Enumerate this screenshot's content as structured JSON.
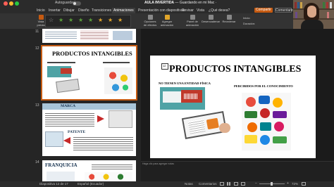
{
  "titlebar": {
    "autosave_label": "Autoguardado",
    "doc_name": "AULA INVERTIDA",
    "doc_status": " — Guardando en mi Mac ·"
  },
  "menu": {
    "items": [
      "Inicio",
      "Insertar",
      "Dibujar",
      "Diseño",
      "Transiciones",
      "Animaciones",
      "Presentación con diapositivas",
      "Revisar",
      "Vista",
      "¿Qué desea?"
    ],
    "active": "Animaciones",
    "share_label": "Compartir",
    "comments_label": "Comentarios"
  },
  "ribbon": {
    "preview_label": "Vista previa",
    "effect_options": "Opciones de efectos",
    "add_animation": "Agregar animación",
    "animation_pane": "Panel de animación",
    "trigger": "Desencadenar",
    "reorder": "Reordenar",
    "start_label": "Inicio:",
    "duration_label": "Duración:"
  },
  "thumbnails": [
    {
      "number": "11"
    },
    {
      "number": "12",
      "title": "PRODUCTOS INTANGIBLES",
      "selected": true
    },
    {
      "number": "13",
      "title": "MARCA",
      "subtitle": "PATENTE"
    },
    {
      "number": "14",
      "title": "FRANQUICIA"
    }
  ],
  "slide": {
    "number": "12",
    "title": "PRODUCTOS INTANGIBLES",
    "left_caption": "NO TIENEN UNA ENTIDAD FÍSICA",
    "right_caption": "PERCIBIDOS POR EL CONOCIMIENTO"
  },
  "notes_placeholder": "Haga clic para agregar notas",
  "status": {
    "slide_counter": "Diapositiva 12 de 17",
    "language": "Español (Ecuador)",
    "notes": "Notas",
    "comments": "Comentarios",
    "zoom": "72%"
  },
  "colors": {
    "accent": "#c55a11",
    "slide_bg": "#ffffff",
    "marca_banner": "#a7c4d8",
    "arrow_red": "#c62828"
  }
}
